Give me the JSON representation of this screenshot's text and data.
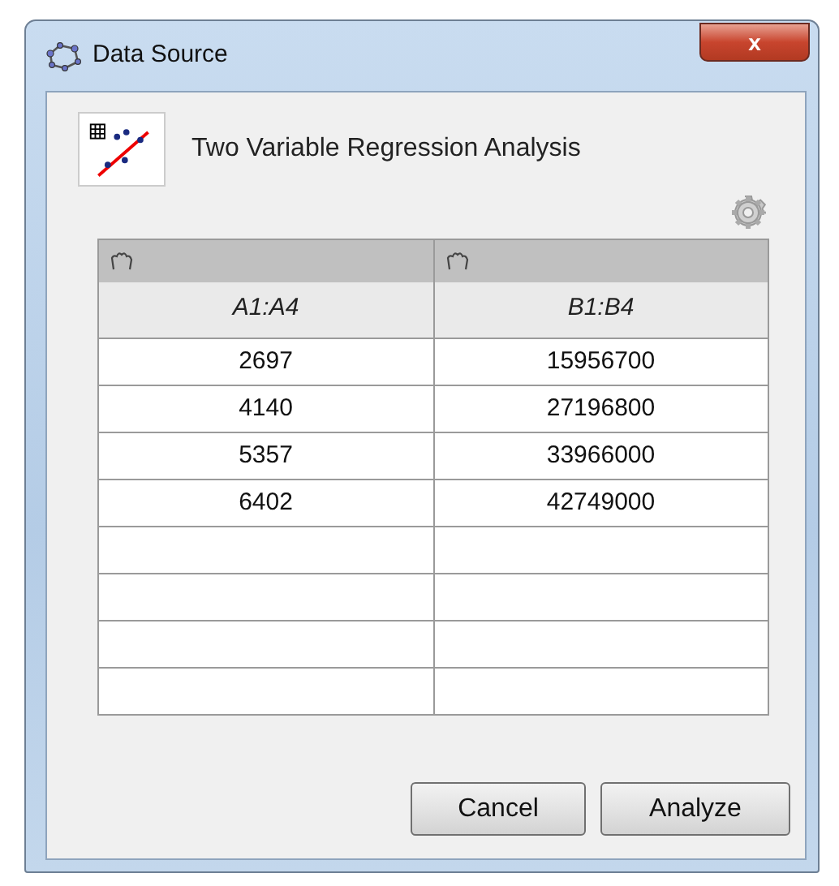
{
  "window": {
    "title": "Data Source",
    "close_label": "x"
  },
  "analysis": {
    "title": "Two Variable Regression Analysis"
  },
  "table": {
    "columns": [
      {
        "label": "A1:A4"
      },
      {
        "label": "B1:B4"
      }
    ],
    "rows": [
      [
        "2697",
        "15956700"
      ],
      [
        "4140",
        "27196800"
      ],
      [
        "5357",
        "33966000"
      ],
      [
        "6402",
        "42749000"
      ]
    ]
  },
  "buttons": [
    {
      "label": "Cancel"
    },
    {
      "label": "Analyze"
    }
  ]
}
